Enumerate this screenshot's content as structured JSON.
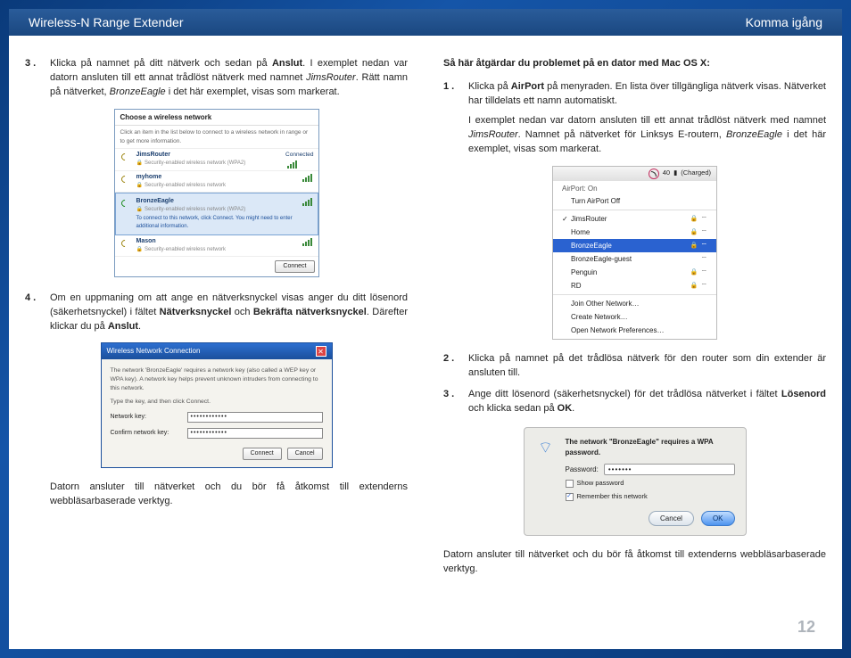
{
  "header": {
    "left": "Wireless-N Range Extender",
    "right": "Komma igång"
  },
  "page_number": "12",
  "left_col": {
    "step3": {
      "num": "3 .",
      "text_a": "Klicka på namnet på ditt nätverk och sedan på ",
      "bold_a": "Anslut",
      "text_b": ". I exemplet nedan var datorn ansluten till ett annat trådlöst nätverk med namnet ",
      "ital_a": "JimsRouter",
      "text_c": ". Rätt namn på nätverket, ",
      "ital_b": "BronzeEagle",
      "text_d": " i det här exemplet, visas som markerat."
    },
    "fig1": {
      "title": "Choose a wireless network",
      "hint": "Click an item in the list below to connect to a wireless network in range or to get more information.",
      "items": [
        {
          "name": "JimsRouter",
          "sub": "Security-enabled wireless network (WPA2)",
          "status": "Connected"
        },
        {
          "name": "myhome",
          "sub": "Security-enabled wireless network"
        },
        {
          "name": "BronzeEagle",
          "sub": "Security-enabled wireless network (WPA2)",
          "selected": true,
          "msg": "To connect to this network, click Connect. You might need to enter additional information."
        },
        {
          "name": "Mason",
          "sub": "Security-enabled wireless network"
        }
      ],
      "connect": "Connect"
    },
    "step4": {
      "num": "4 .",
      "text_a": "Om en uppmaning om att ange en nätverksnyckel visas anger du ditt lösenord (säkerhetsnyckel) i fältet ",
      "bold_a": "Nätverksnyckel",
      "text_b": " och ",
      "bold_b": "Bekräfta nätverksnyckel",
      "text_c": ". Därefter klickar du på ",
      "bold_c": "Anslut",
      "text_d": "."
    },
    "fig2": {
      "title": "Wireless Network Connection",
      "msg1": "The network 'BronzeEagle' requires a network key (also called a WEP key or WPA key). A network key helps prevent unknown intruders from connecting to this network.",
      "msg2": "Type the key, and then click Connect.",
      "label1": "Network key:",
      "label2": "Confirm network key:",
      "val": "••••••••••••",
      "connect": "Connect",
      "cancel": "Cancel"
    },
    "after": "Datorn ansluter till nätverket och du bör få åtkomst till extenderns webbläsarbaserade verktyg."
  },
  "right_col": {
    "heading": "Så här åtgärdar du problemet på en dator med Mac OS X:",
    "step1": {
      "num": "1 .",
      "text_a": "Klicka på ",
      "bold_a": "AirPort",
      "text_b": " på menyraden. En lista över tillgängliga nätverk visas. Nätverket har tilldelats ett namn automatiskt.",
      "para2_a": "I exemplet nedan var datorn ansluten till ett annat trådlöst nätverk med namnet ",
      "para2_i1": "JimsRouter",
      "para2_b": ". Namnet på nätverket för Linksys E-routern, ",
      "para2_i2": "BronzeEagle",
      "para2_c": " i det här exemplet, visas som markerat."
    },
    "fig3": {
      "menubar": {
        "charged": "(Charged)",
        "time": "40"
      },
      "airport_on": "AirPort: On",
      "turn_off": "Turn AirPort Off",
      "networks": [
        {
          "name": "JimsRouter",
          "checked": true,
          "lock": true
        },
        {
          "name": "Home",
          "lock": true
        },
        {
          "name": "BronzeEagle",
          "selected": true,
          "lock": true
        },
        {
          "name": "BronzeEagle-guest"
        },
        {
          "name": "Penguin",
          "lock": true
        },
        {
          "name": "RD",
          "lock": true
        }
      ],
      "join": "Join Other Network…",
      "create": "Create Network…",
      "prefs": "Open Network Preferences…"
    },
    "step2": {
      "num": "2 .",
      "text": "Klicka på namnet på det trådlösa nätverk för den router som din extender är ansluten till."
    },
    "step3": {
      "num": "3 .",
      "text_a": "Ange ditt lösenord (säkerhetsnyckel) för det trådlösa nätverket i fältet ",
      "bold_a": "Lösenord",
      "text_b": " och klicka sedan på ",
      "bold_b": "OK",
      "text_c": "."
    },
    "fig4": {
      "msg": "The network \"BronzeEagle\" requires a WPA password.",
      "pwd_label": "Password:",
      "pwd_val": "•••••••",
      "show": "Show password",
      "remember": "Remember this network",
      "cancel": "Cancel",
      "ok": "OK"
    },
    "after": "Datorn ansluter till nätverket och du bör få åtkomst till extenderns webbläsarbaserade verktyg."
  }
}
